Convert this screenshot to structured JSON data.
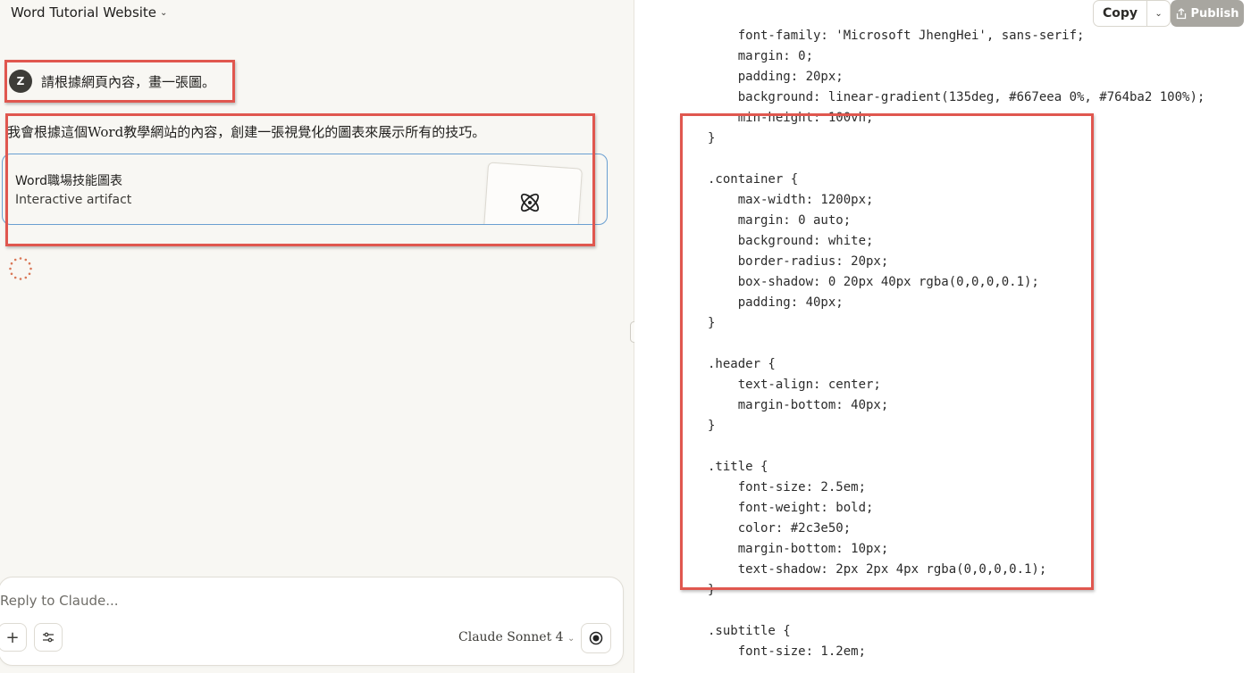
{
  "project": {
    "title": "Word Tutorial Website"
  },
  "user_message": {
    "avatar_initial": "Z",
    "text": "請根據網頁內容，畫一張圖。"
  },
  "assistant_message": {
    "text": "我會根據這個Word教學網站的內容，創建一張視覺化的圖表來展示所有的技巧。"
  },
  "artifact": {
    "title": "Word職場技能圖表",
    "subtitle": "Interactive artifact",
    "icon": "atom-icon"
  },
  "composer": {
    "placeholder": "Reply to Claude...",
    "add_icon": "plus-icon",
    "tools_icon": "sliders-icon",
    "model": "Claude Sonnet 4",
    "record_icon": "record-icon"
  },
  "toolbar": {
    "copy_label": "Copy",
    "publish_label": "Publish"
  },
  "code": {
    "lines": [
      "    font-family: 'Microsoft JhengHei', sans-serif;",
      "    margin: 0;",
      "    padding: 20px;",
      "    background: linear-gradient(135deg, #667eea 0%, #764ba2 100%);",
      "    min-height: 100vh;",
      "}",
      "",
      ".container {",
      "    max-width: 1200px;",
      "    margin: 0 auto;",
      "    background: white;",
      "    border-radius: 20px;",
      "    box-shadow: 0 20px 40px rgba(0,0,0,0.1);",
      "    padding: 40px;",
      "}",
      "",
      ".header {",
      "    text-align: center;",
      "    margin-bottom: 40px;",
      "}",
      "",
      ".title {",
      "    font-size: 2.5em;",
      "    font-weight: bold;",
      "    color: #2c3e50;",
      "    margin-bottom: 10px;",
      "    text-shadow: 2px 2px 4px rgba(0,0,0,0.1);",
      "}",
      "",
      ".subtitle {",
      "    font-size: 1.2em;"
    ]
  },
  "colors": {
    "annotation": "#e0574f",
    "artifact_border": "#6a9fd1",
    "spinner": "#d97757"
  }
}
